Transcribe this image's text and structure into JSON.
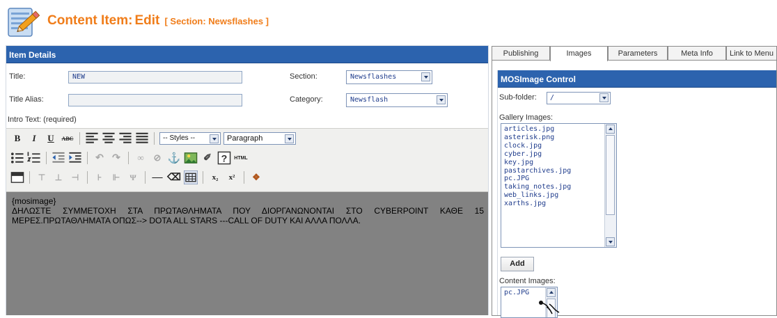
{
  "header": {
    "title": "Content Item:",
    "mode": "Edit",
    "section_tag": "[ Section: Newsflashes ]",
    "icon": "edit-pencil-notepad-icon"
  },
  "item_details": {
    "heading": "Item Details",
    "title_label": "Title:",
    "title_value": "NEW",
    "alias_label": "Title Alias:",
    "alias_value": "",
    "section_label": "Section:",
    "section_value": "Newsflashes",
    "category_label": "Category:",
    "category_value": "Newsflash",
    "intro_label": "Intro Text: (required)"
  },
  "editor": {
    "styles_select": "-- Styles --",
    "format_select": "Paragraph",
    "html_label": "HTML",
    "content_line1": "{mosimage}",
    "content_para": "ΔΗΛΩΣΤΕ ΣΥΜΜΕΤΟΧΗ ΣΤΑ ΠΡΩΤΑΘΛΗΜΑΤΑ ΠΟΥ ΔΙΟΡΓΑΝΩΝΟΝΤΑΙ ΣΤΟ CYBERPOINT ΚΑΘΕ 15 ΜΕΡΕΣ.ΠΡΩΤΑΘΛΗΜΑΤΑ ΟΠΩΣ--> DOTA ALL STARS ---CALL OF DUTY ΚΑΙ ΑΛΛΑ ΠΟΛΛΑ."
  },
  "tabs": [
    {
      "label": "Publishing"
    },
    {
      "label": "Images"
    },
    {
      "label": "Parameters"
    },
    {
      "label": "Meta Info"
    },
    {
      "label": "Link to Menu"
    }
  ],
  "active_tab": "Images",
  "mosimage": {
    "heading": "MOSImage Control",
    "subfolder_label": "Sub-folder:",
    "subfolder_value": "/",
    "gallery_label": "Gallery Images:",
    "gallery_images": [
      "articles.jpg",
      "asterisk.png",
      "clock.jpg",
      "cyber.jpg",
      "key.jpg",
      "pastarchives.jpg",
      "pc.JPG",
      "taking_notes.jpg",
      "web_links.jpg",
      "xarths.jpg"
    ],
    "add_button": "Add",
    "content_label": "Content Images:",
    "content_images": [
      "pc.JPG"
    ]
  },
  "colors": {
    "brand_orange": "#f07d1a",
    "bar_blue": "#2c63ae",
    "editor_bg": "#828282"
  }
}
